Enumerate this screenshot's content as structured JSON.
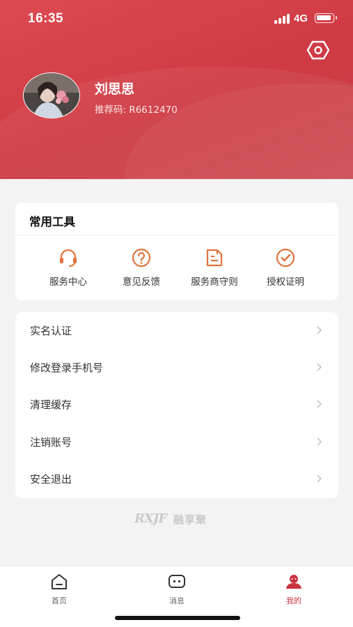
{
  "status_bar": {
    "time": "16:35",
    "network": "4G"
  },
  "colors": {
    "accent": "#c9343e",
    "icon_orange": "#e0733a",
    "header": "#d4404a"
  },
  "header": {
    "settings_icon": "hexagon-gear-icon"
  },
  "profile": {
    "name": "刘思思",
    "referral": "推荐码: R6612470"
  },
  "tools": {
    "title": "常用工具",
    "items": [
      {
        "label": "服务中心",
        "icon": "headset-icon"
      },
      {
        "label": "意见反馈",
        "icon": "question-circle-icon"
      },
      {
        "label": "服务商守则",
        "icon": "document-icon"
      },
      {
        "label": "授权证明",
        "icon": "check-circle-icon"
      }
    ]
  },
  "menu": {
    "items": [
      {
        "label": "实名认证"
      },
      {
        "label": "修改登录手机号"
      },
      {
        "label": "清理缓存"
      },
      {
        "label": "注销账号"
      },
      {
        "label": "安全退出"
      }
    ]
  },
  "watermark": {
    "logo": "RXJF",
    "text": "融享聚"
  },
  "tabbar": {
    "tabs": [
      {
        "label": "首页",
        "icon": "home-icon"
      },
      {
        "label": "消息",
        "icon": "message-icon"
      },
      {
        "label": "我的",
        "icon": "profile-icon",
        "active": true
      }
    ]
  }
}
